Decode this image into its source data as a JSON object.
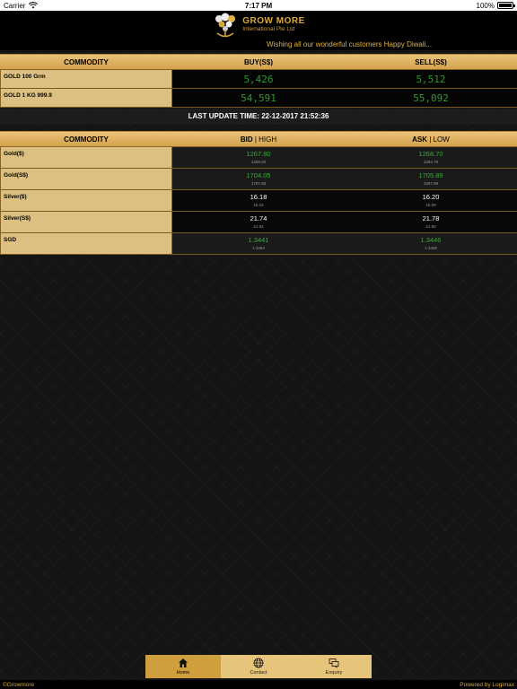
{
  "status_bar": {
    "carrier": "Carrier",
    "time": "7:17 PM",
    "battery": "100%",
    "battery_level": 1.0
  },
  "header": {
    "logo_title": "GROW MORE",
    "logo_subtitle": "International Pte Ltd"
  },
  "marquee": "Wishing all our wonderful customers Happy Diwali...",
  "table1": {
    "headers": [
      "COMMODITY",
      "BUY(S$)",
      "SELL(S$)"
    ],
    "rows": [
      {
        "name": "GOLD 100 Grm",
        "buy": "5,426",
        "sell": "5,512"
      },
      {
        "name": "GOLD 1 KG 999.9",
        "buy": "54,591",
        "sell": "55,092"
      }
    ]
  },
  "last_update": "LAST UPDATE TIME: 22-12-2017 21:52:36",
  "table2": {
    "headers": {
      "commodity": "COMMODITY",
      "bid": "BID",
      "high": "HIGH",
      "ask": "ASK",
      "low": "LOW",
      "separator": "|"
    },
    "rows": [
      {
        "name": "Gold($)",
        "bid": "1267.80",
        "high": "1269.20",
        "ask": "1268.70",
        "low": "1264.70"
      },
      {
        "name": "Gold(S$)",
        "bid": "1704.05",
        "high": "1707.58",
        "ask": "1705.89",
        "low": "1697.99"
      },
      {
        "name": "Silver($)",
        "bid": "16.18",
        "high": "16.22",
        "ask": "16.20",
        "low": "16.09"
      },
      {
        "name": "Silver(S$)",
        "bid": "21.74",
        "high": "21.84",
        "ask": "21.78",
        "low": "21.60"
      },
      {
        "name": "SGD",
        "bid": "1.3441",
        "high": "1.3494",
        "ask": "1.3446",
        "low": "1.3408"
      }
    ]
  },
  "tabs": [
    {
      "label": "Home",
      "icon": "home-icon"
    },
    {
      "label": "Contact",
      "icon": "globe-icon"
    },
    {
      "label": "Enquiry",
      "icon": "chat-icon"
    }
  ],
  "footer": {
    "left": "©Growmore",
    "right": "Powered by Logimax"
  },
  "colors": {
    "gold": "#d4a24c",
    "price_green": "#2c9a2c",
    "background": "#141414"
  }
}
